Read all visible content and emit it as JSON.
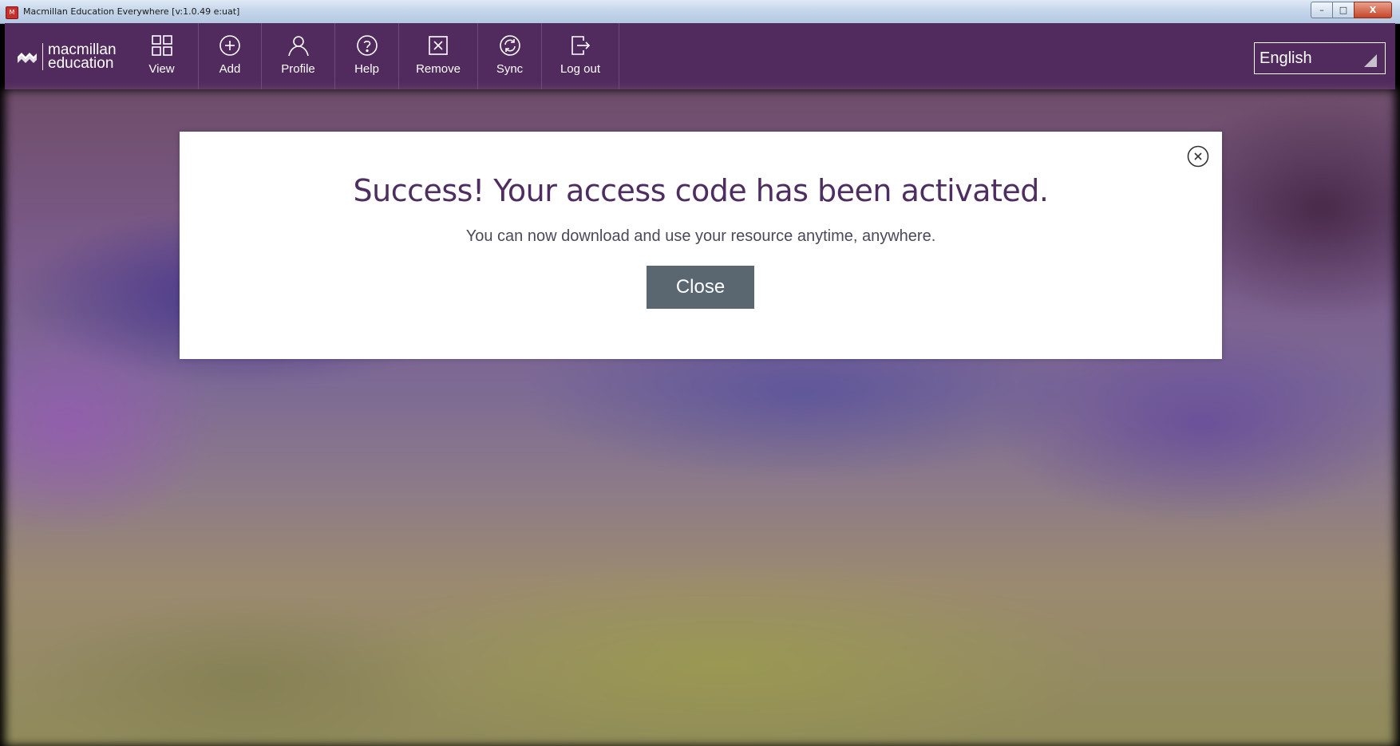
{
  "window": {
    "title": "Macmillan Education Everywhere [v:1.0.49 e:uat]",
    "app_icon_glyph": "M",
    "minimize_glyph": "–",
    "maximize_glyph": "□",
    "close_glyph": "X"
  },
  "toolbar": {
    "logo_line1": "macmillan",
    "logo_line2": "education",
    "items": [
      {
        "label": "View",
        "icon": "grid-icon"
      },
      {
        "label": "Add",
        "icon": "plus-circle-icon"
      },
      {
        "label": "Profile",
        "icon": "person-icon"
      },
      {
        "label": "Help",
        "icon": "help-icon"
      },
      {
        "label": "Remove",
        "icon": "remove-icon"
      },
      {
        "label": "Sync",
        "icon": "sync-icon"
      },
      {
        "label": "Log out",
        "icon": "logout-icon"
      }
    ],
    "language": "English"
  },
  "modal": {
    "title": "Success! Your access code has been activated.",
    "message": "You can now download and use your resource anytime, anywhere.",
    "close_label": "Close"
  },
  "colors": {
    "toolbar_bg": "#512a5e",
    "title_color": "#4e2e61",
    "button_bg": "#5b6770"
  }
}
